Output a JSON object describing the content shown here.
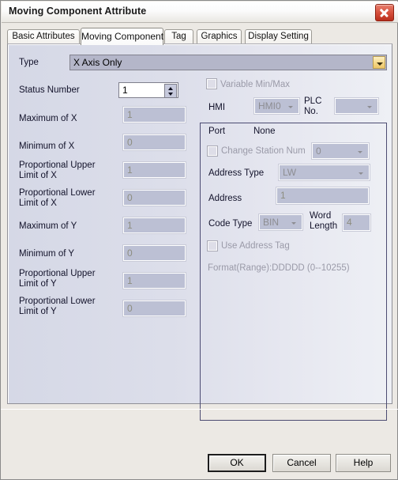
{
  "window": {
    "title": "Moving Component Attribute",
    "close_icon": "close-icon"
  },
  "tabs": [
    {
      "label": "Basic Attributes",
      "active": false
    },
    {
      "label": "Moving Component",
      "active": true
    },
    {
      "label": "Tag",
      "active": false
    },
    {
      "label": "Graphics",
      "active": false
    },
    {
      "label": "Display Setting",
      "active": false
    }
  ],
  "left_panel": {
    "type_label": "Type",
    "type_value": "X Axis Only",
    "status_number_label": "Status Number",
    "status_number_value": "1",
    "fields": [
      {
        "label": "Maximum of X",
        "value": "1"
      },
      {
        "label": "Minimum of X",
        "value": "0"
      },
      {
        "label": "Proportional Upper\nLimit of X",
        "value": "1"
      },
      {
        "label": "Proportional Lower\nLimit of X",
        "value": "0"
      },
      {
        "label": "Maximum of Y",
        "value": "1"
      },
      {
        "label": "Minimum of Y",
        "value": "0"
      },
      {
        "label": "Proportional Upper\nLimit of Y",
        "value": "1"
      },
      {
        "label": "Proportional Lower\nLimit of Y",
        "value": "0"
      }
    ]
  },
  "right_panel": {
    "group_legend": "Variable Min/Max",
    "hmi_label": "HMI",
    "hmi_value": "HMI0",
    "plc_no_label": "PLC\nNo.",
    "plc_no_value": "",
    "port_label": "Port",
    "port_value": "None",
    "change_station_label": "Change Station Num",
    "change_station_value": "0",
    "address_type_label": "Address Type",
    "address_type_value": "LW",
    "address_label": "Address",
    "address_value": "1",
    "code_type_label": "Code Type",
    "code_type_value": "BIN",
    "word_length_label": "Word\nLength",
    "word_length_value": "4",
    "use_address_tag_label": "Use Address Tag",
    "format_range_text": "Format(Range):DDDDD (0--10255)"
  },
  "footer": {
    "ok_label": "OK",
    "cancel_label": "Cancel",
    "help_label": "Help"
  }
}
